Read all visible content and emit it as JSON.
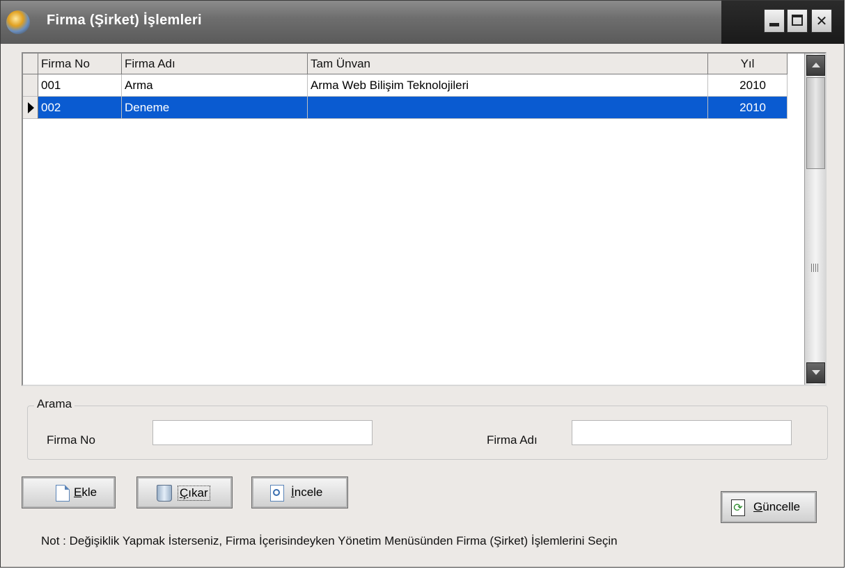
{
  "window": {
    "title": "Firma (Şirket) İşlemleri"
  },
  "grid": {
    "columns": [
      "Firma No",
      "Firma Adı",
      "Tam Ünvan",
      "Yıl"
    ],
    "rows": [
      {
        "no": "001",
        "name": "Arma",
        "title": "Arma Web Bilişim Teknolojileri",
        "year": "2010",
        "selected": false
      },
      {
        "no": "002",
        "name": "Deneme",
        "title": "",
        "year": "2010",
        "selected": true
      }
    ],
    "selection_color": "#0a5bd1"
  },
  "search": {
    "legend": "Arama",
    "firma_no_label": "Firma No",
    "firma_no_value": "",
    "firma_adi_label": "Firma Adı",
    "firma_adi_value": ""
  },
  "buttons": {
    "ekle_u": "E",
    "ekle_rest": "kle",
    "cikar_u": "Ç",
    "cikar_rest": "ıkar",
    "incele_u": "İ",
    "incele_rest": "ncele",
    "guncelle_u": "G",
    "guncelle_rest": "üncelle"
  },
  "note": "Not : Değişiklik Yapmak İsterseniz, Firma İçerisindeyken Yönetim Menüsünden Firma (Şirket) İşlemlerini Seçin",
  "icons": {
    "app": "globe-icon",
    "ekle": "new-document-icon",
    "cikar": "trash-icon",
    "incele": "magnifier-document-icon",
    "guncelle": "refresh-icon"
  }
}
